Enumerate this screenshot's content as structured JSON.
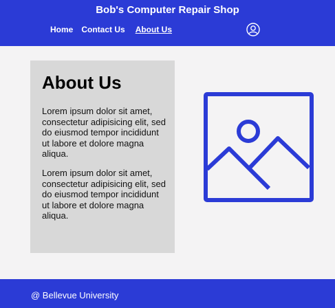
{
  "header": {
    "title": "Bob's Computer Repair Shop",
    "nav": [
      {
        "label": "Home"
      },
      {
        "label": "Contact Us"
      },
      {
        "label": "About Us",
        "active": true
      }
    ],
    "user_icon": "user-account-icon"
  },
  "main": {
    "heading": "About Us",
    "paragraphs": [
      "Lorem ipsum dolor sit amet, consectetur adipisicing elit, sed do eiusmod tempor incididunt ut labore et dolore magna aliqua.",
      "Lorem ipsum dolor sit amet, consectetur adipisicing elit, sed do eiusmod tempor incididunt ut labore et dolore magna aliqua."
    ],
    "image_icon": "image-placeholder-icon"
  },
  "footer": {
    "text": "@ Bellevue University"
  },
  "colors": {
    "brand": "#2b3bd6",
    "background": "#f4f3f4",
    "card": "#d8d8d8",
    "text_on_brand": "#ffffff"
  }
}
